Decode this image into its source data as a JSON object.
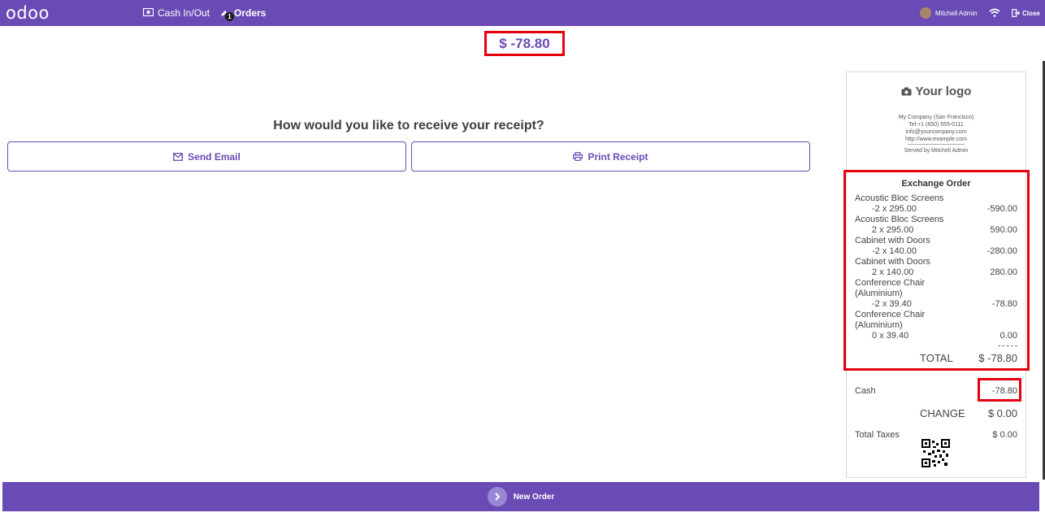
{
  "topbar": {
    "logo": "odoo",
    "cash_label": "Cash In/Out",
    "orders_label": "Orders",
    "orders_badge": "1",
    "user_name": "Mitchell Admin",
    "close_label": "Close"
  },
  "amount_due": "$ -78.80",
  "receipt_question": "How would you like to receive your receipt?",
  "buttons": {
    "send_email": "Send Email",
    "print_receipt": "Print Receipt",
    "new_order": "New Order"
  },
  "receipt": {
    "logo_text": "Your logo",
    "company": [
      "My Company (San Francisco)",
      "Tel:+1 (650) 555-0111",
      "info@yourcompany.com",
      "http://www.example.com"
    ],
    "served_by": "Served by Mitchell Admin",
    "title": "Exchange Order",
    "lines": [
      {
        "name": "Acoustic Bloc Screens",
        "qty_price": "-2 x 295.00",
        "amount": "-590.00"
      },
      {
        "name": "Acoustic Bloc Screens",
        "qty_price": "2 x 295.00",
        "amount": "590.00"
      },
      {
        "name": "Cabinet with Doors",
        "qty_price": "-2 x 140.00",
        "amount": "-280.00"
      },
      {
        "name": "Cabinet with Doors",
        "qty_price": "2 x 140.00",
        "amount": "280.00"
      },
      {
        "name": "Conference Chair (Aluminium)",
        "qty_price": "-2 x 39.40",
        "amount": "-78.80"
      },
      {
        "name": "Conference Chair (Aluminium)",
        "qty_price": "0 x 39.40",
        "amount": "0.00"
      }
    ],
    "total_label": "TOTAL",
    "total_value": "$ -78.80",
    "cash_label": "Cash",
    "cash_value": "-78.80",
    "change_label": "CHANGE",
    "change_value": "$ 0.00",
    "taxes_label": "Total Taxes",
    "taxes_value": "$ 0.00"
  },
  "colors": {
    "brand": "#6a4bb5",
    "highlight": "#e4000f"
  }
}
